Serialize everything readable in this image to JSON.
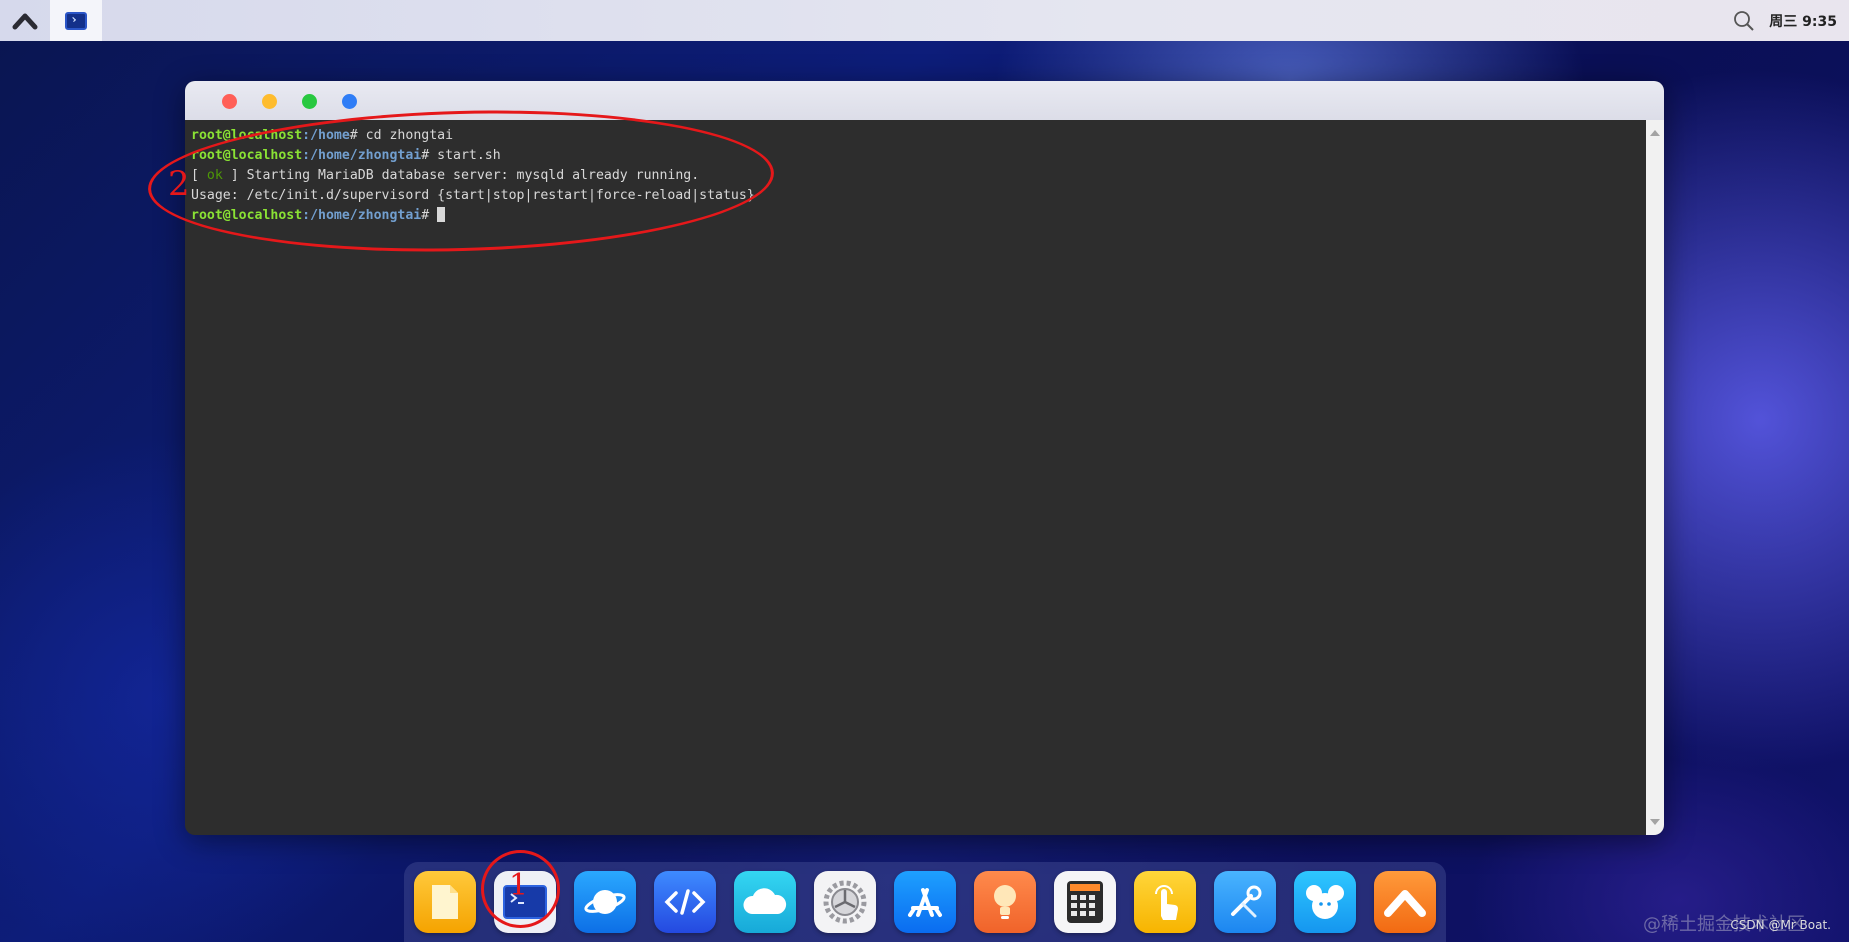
{
  "topbar": {
    "clock": "周三 9:35"
  },
  "terminal": {
    "lines": [
      {
        "user": "root@localhost",
        "path": ":/home",
        "cmd": "# cd zhongtai"
      },
      {
        "user": "root@localhost",
        "path": ":/home/zhongtai",
        "cmd": "# start.sh"
      },
      {
        "pre": "[ ",
        "ok": "ok",
        "post": " ] Starting MariaDB database server: mysqld already running."
      },
      {
        "text": "Usage: /etc/init.d/supervisord {start|stop|restart|force-reload|status}"
      },
      {
        "user": "root@localhost",
        "path": ":/home/zhongtai",
        "cmd": "# "
      }
    ]
  },
  "annotations": {
    "label_1": "1",
    "label_2": "2"
  },
  "dock": {
    "apps": [
      "files-icon",
      "terminal-icon",
      "browser-icon",
      "code-editor-icon",
      "cloud-icon",
      "settings-icon",
      "app-store-icon",
      "tips-icon",
      "calculator-icon",
      "touch-icon",
      "tools-icon",
      "mouse-icon",
      "launcher-icon"
    ]
  },
  "watermark": {
    "text1": "@稀土掘金技术社区",
    "text2": "CSDN @Mr Boat."
  }
}
